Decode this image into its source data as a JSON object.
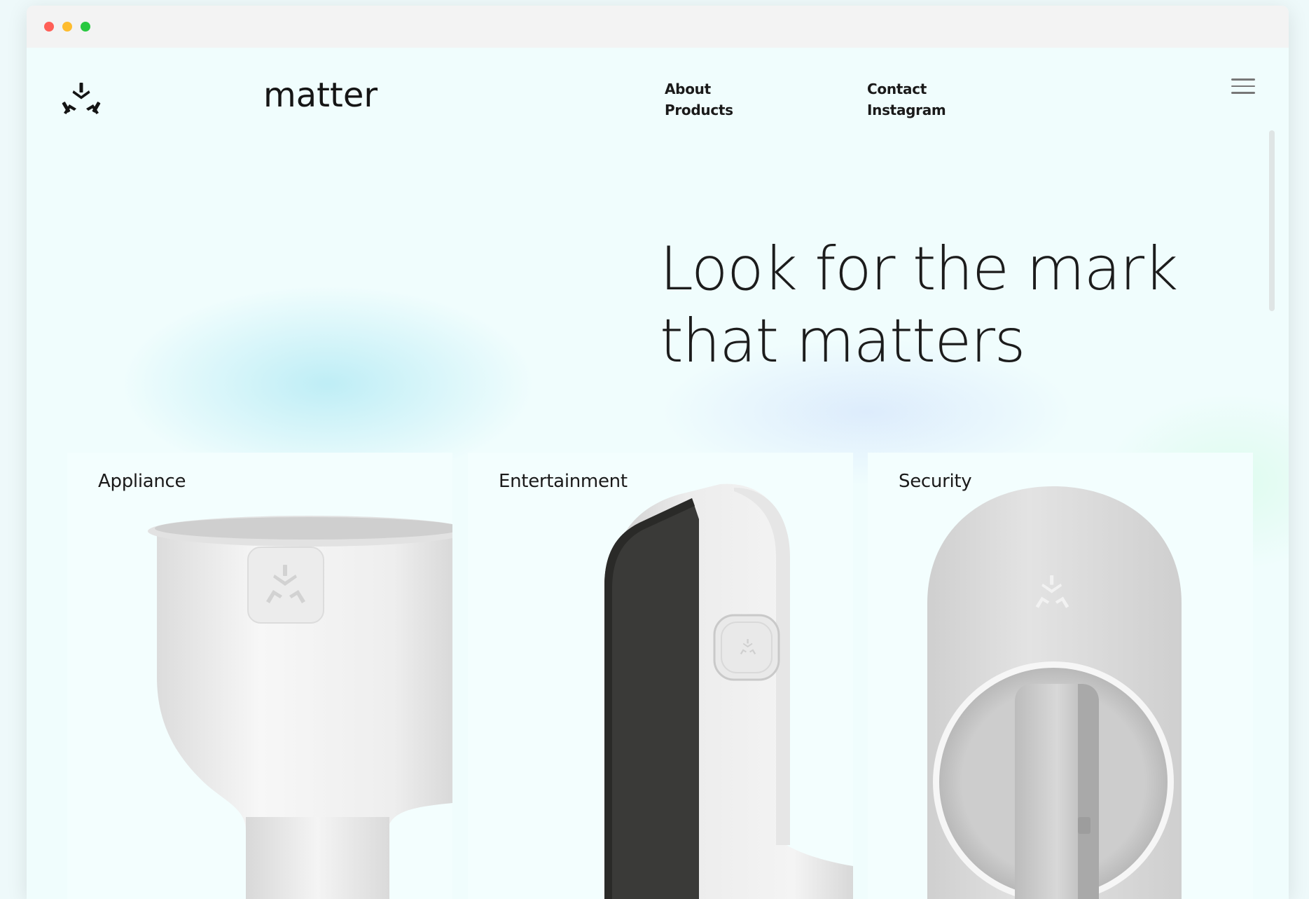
{
  "window": {
    "controls": [
      "close",
      "minimize",
      "zoom"
    ],
    "colors": {
      "close": "#ff5f57",
      "minimize": "#febc2e",
      "zoom": "#28c840"
    }
  },
  "header": {
    "logo_icon": "matter-logo-icon",
    "brand": "matter",
    "nav_col1": [
      "About",
      "Products"
    ],
    "nav_col2": [
      "Contact",
      "Instagram"
    ],
    "menu_icon": "hamburger-menu-icon"
  },
  "hero": {
    "line1": "Look for the mark",
    "line2": "that matters"
  },
  "cards": [
    {
      "title": "Appliance",
      "image": "smart-bulb-image"
    },
    {
      "title": "Entertainment",
      "image": "smart-display-image"
    },
    {
      "title": "Security",
      "image": "smart-lock-image"
    }
  ]
}
